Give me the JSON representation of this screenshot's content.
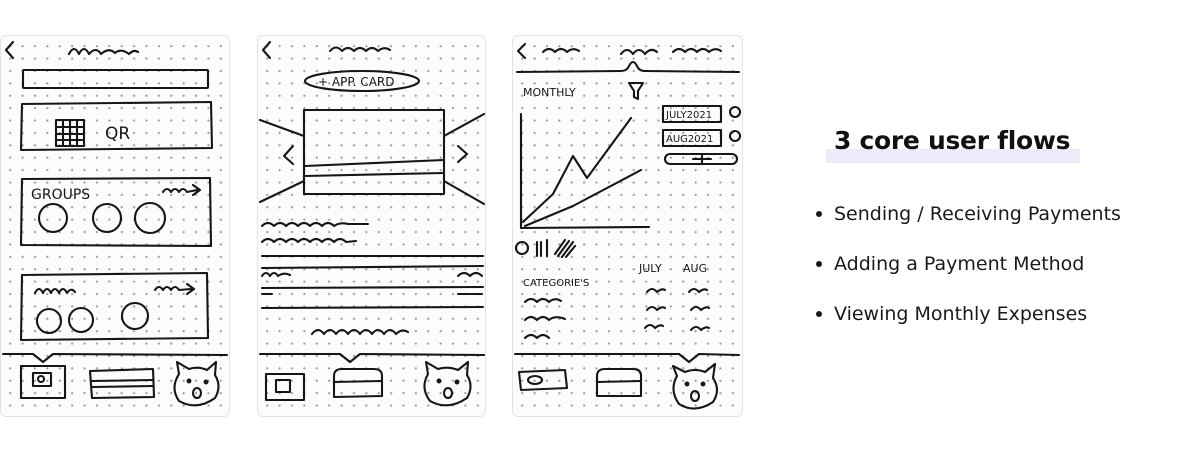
{
  "sketch_1": {
    "qr_label": "QR",
    "groups_label": "GROUPS"
  },
  "sketch_2": {
    "add_card_label": "+ APP. CARD"
  },
  "sketch_3": {
    "monthly_label": "MONTHLY",
    "month_1": "JULY2021",
    "month_2": "AUG2021",
    "categories_label": "CATEGORIE'S",
    "col_july": "JULY",
    "col_aug": "AUG"
  },
  "panel": {
    "title": "3 core user flows",
    "flows": [
      "Sending / Receiving Payments",
      "Adding a Payment Method",
      "Viewing Monthly Expenses"
    ]
  },
  "colors": {
    "ink": "#161616",
    "highlight": "#ecebfa",
    "card_border": "#e3e3e6"
  }
}
